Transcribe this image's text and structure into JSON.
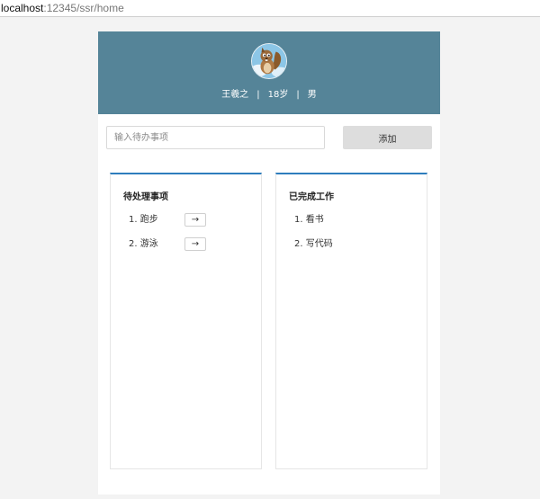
{
  "browser": {
    "url_host": "localhost",
    "url_path": ":12345/ssr/home"
  },
  "header": {
    "name": "王羲之",
    "age": "18岁",
    "gender": "男",
    "separator": "|",
    "background_color": "#558498"
  },
  "form": {
    "placeholder": "输入待办事项",
    "value": "",
    "add_label": "添加"
  },
  "pending": {
    "title": "待处理事项",
    "items": [
      {
        "index": "1.",
        "label": "跑步",
        "action": "→"
      },
      {
        "index": "2.",
        "label": "游泳",
        "action": "→"
      }
    ]
  },
  "done": {
    "title": "已完成工作",
    "items": [
      {
        "index": "1.",
        "label": "看书"
      },
      {
        "index": "2.",
        "label": "写代码"
      }
    ]
  },
  "colors": {
    "accent": "#2e7dbd",
    "button_bg": "#dddddd"
  },
  "icons": {
    "avatar": "squirrel-avatar-icon",
    "move": "arrow-right-icon"
  }
}
